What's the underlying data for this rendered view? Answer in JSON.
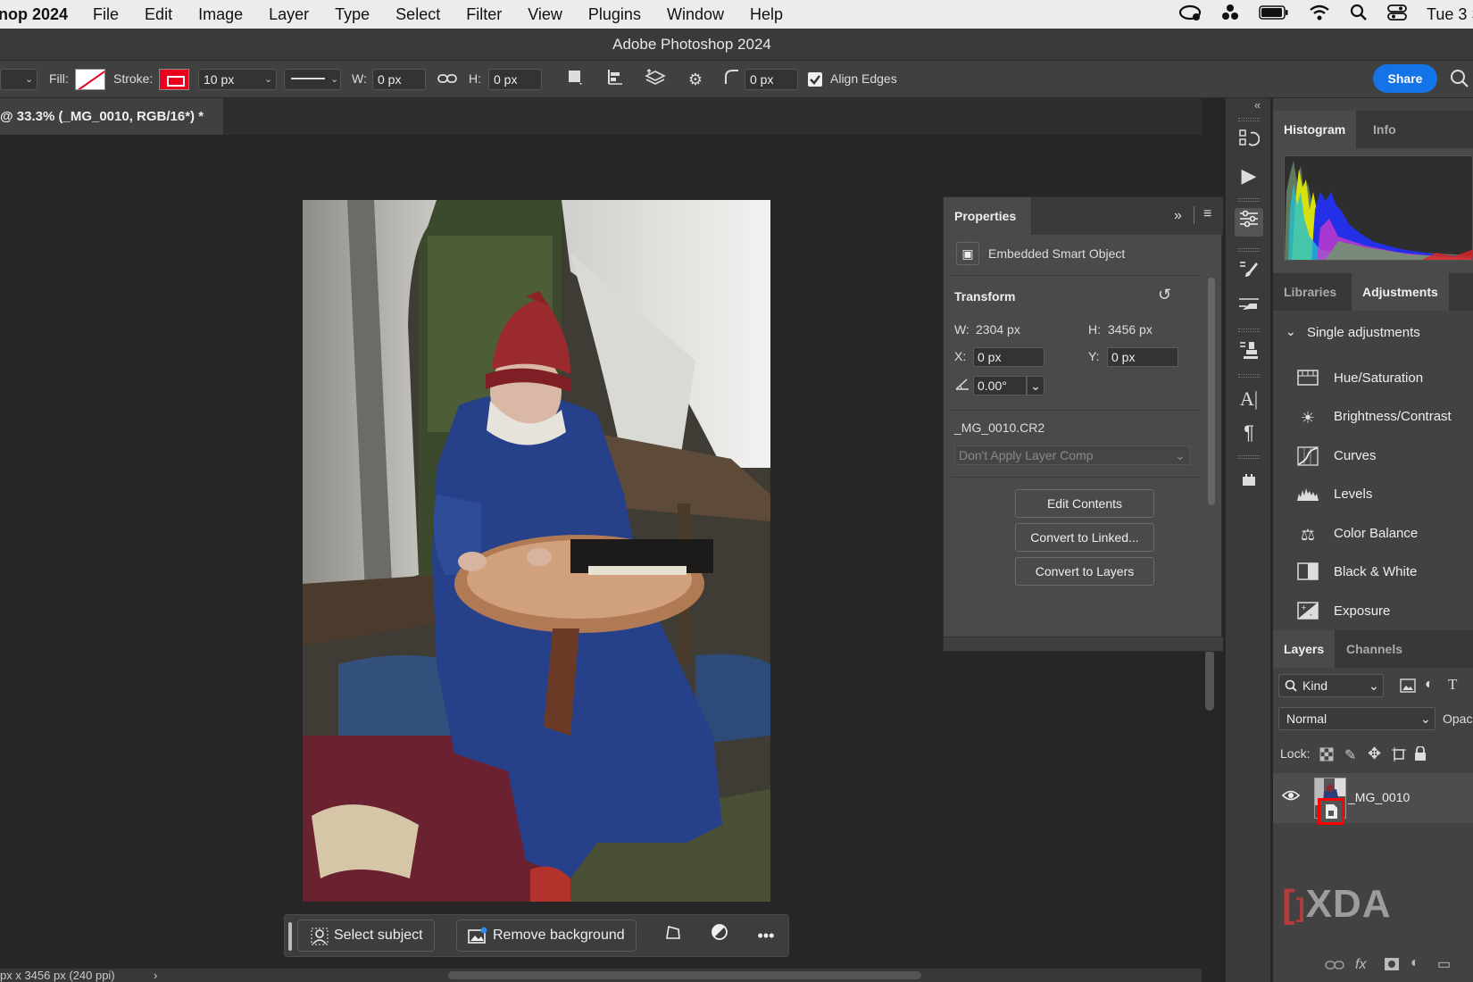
{
  "menubar": {
    "app_name": "nop 2024",
    "items": [
      "File",
      "Edit",
      "Image",
      "Layer",
      "Type",
      "Select",
      "Filter",
      "View",
      "Plugins",
      "Window",
      "Help"
    ],
    "clock": "Tue 3 S"
  },
  "window": {
    "title": "Adobe Photoshop 2024"
  },
  "options_bar": {
    "fill_label": "Fill:",
    "stroke_label": "Stroke:",
    "stroke_width": "10 px",
    "w_label": "W:",
    "w_value": "0 px",
    "h_label": "H:",
    "h_value": "0 px",
    "radius_value": "0 px",
    "align_edges_label": "Align Edges",
    "align_edges_checked": true,
    "share_label": "Share"
  },
  "document": {
    "tab_label": "@ 33.3% (_MG_0010, RGB/16*) *",
    "status_text": "px x 3456 px (240 ppi)"
  },
  "task_bar": {
    "select_subject": "Select subject",
    "remove_background": "Remove background"
  },
  "properties": {
    "tab": "Properties",
    "object_type": "Embedded Smart Object",
    "transform_label": "Transform",
    "w_label": "W:",
    "w_value": "2304 px",
    "h_label": "H:",
    "h_value": "3456 px",
    "x_label": "X:",
    "x_value": "0 px",
    "y_label": "Y:",
    "y_value": "0 px",
    "angle_value": "0.00°",
    "filename": "_MG_0010.CR2",
    "layer_comp": "Don't Apply Layer Comp",
    "buttons": [
      "Edit Contents",
      "Convert to Linked...",
      "Convert to Layers"
    ]
  },
  "right_panels": {
    "histogram_tabs": [
      "Histogram",
      "Info"
    ],
    "lib_tabs": [
      "Libraries",
      "Adjustments"
    ],
    "single_adjustments": "Single adjustments",
    "adjustments": [
      {
        "label": "Hue/Saturation",
        "icon": "hue-saturation-icon"
      },
      {
        "label": "Brightness/Contrast",
        "icon": "brightness-icon"
      },
      {
        "label": "Curves",
        "icon": "curves-icon"
      },
      {
        "label": "Levels",
        "icon": "levels-icon"
      },
      {
        "label": "Color Balance",
        "icon": "color-balance-icon"
      },
      {
        "label": "Black & White",
        "icon": "black-white-icon"
      },
      {
        "label": "Exposure",
        "icon": "exposure-icon"
      }
    ],
    "layer_tabs": [
      "Layers",
      "Channels"
    ],
    "kind_label": "Kind",
    "blend_mode": "Normal",
    "opacity_label": "Opac",
    "lock_label": "Lock:",
    "layer_name": "_MG_0010",
    "watermark": "XDA"
  }
}
